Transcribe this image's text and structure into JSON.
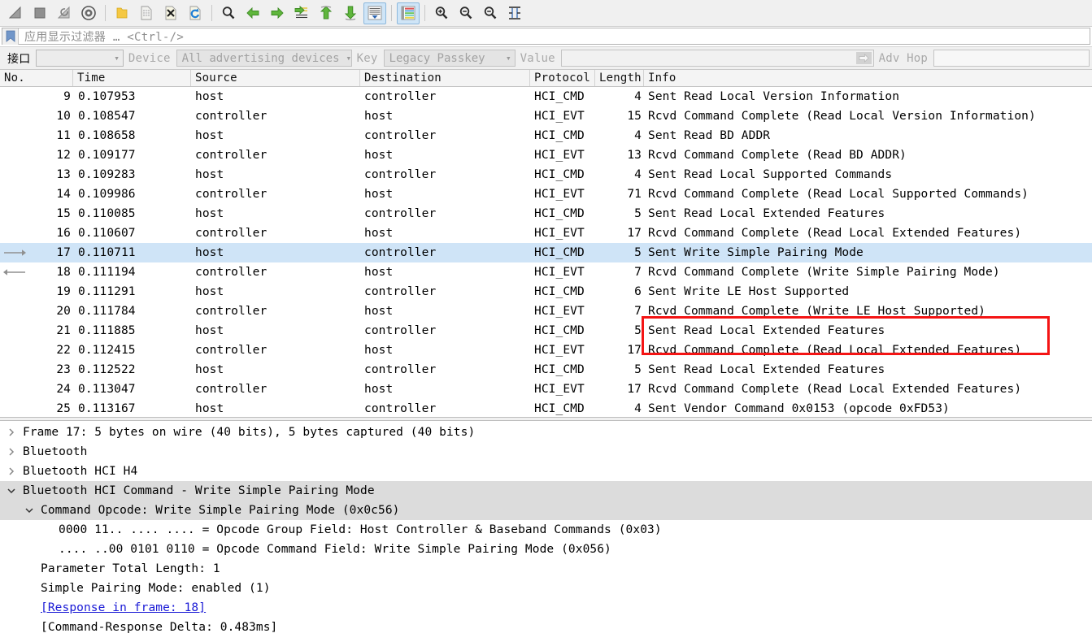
{
  "toolbar": {
    "buttons": [
      {
        "name": "start-capture-icon",
        "label": "Start"
      },
      {
        "name": "stop-capture-icon",
        "label": "Stop"
      },
      {
        "name": "restart-capture-icon",
        "label": "Restart"
      },
      {
        "name": "capture-options-icon",
        "label": "Capture Options"
      },
      {
        "name": "open-file-icon",
        "label": "Open"
      },
      {
        "name": "save-file-icon",
        "label": "Save"
      },
      {
        "name": "close-file-icon",
        "label": "Close"
      },
      {
        "name": "reload-file-icon",
        "label": "Reload"
      },
      {
        "name": "find-packet-icon",
        "label": "Find Packet"
      },
      {
        "name": "go-back-icon",
        "label": "Go Back"
      },
      {
        "name": "go-forward-icon",
        "label": "Go Forward"
      },
      {
        "name": "go-to-packet-icon",
        "label": "Go to Packet"
      },
      {
        "name": "go-to-first-icon",
        "label": "Go to First"
      },
      {
        "name": "go-to-last-icon",
        "label": "Go to Last"
      },
      {
        "name": "auto-scroll-icon",
        "label": "Auto Scroll in Live Capture",
        "active": true
      },
      {
        "name": "colorize-icon",
        "label": "Colorize Packet List",
        "active": true
      },
      {
        "name": "zoom-in-icon",
        "label": "Zoom In"
      },
      {
        "name": "zoom-out-icon",
        "label": "Zoom Out"
      },
      {
        "name": "normal-size-icon",
        "label": "Normal Size"
      },
      {
        "name": "resize-columns-icon",
        "label": "Resize Columns"
      }
    ]
  },
  "display_filter": {
    "bookmark_icon": "bookmark-icon",
    "placeholder": "应用显示过滤器 … <Ctrl-/>",
    "value": ""
  },
  "bt_toolbar": {
    "interface_label": "接口",
    "interface_value": "",
    "device_label": "Device",
    "device_value": "All advertising devices",
    "key_label": "Key",
    "key_value": "Legacy Passkey",
    "value_label": "Value",
    "value_value": "",
    "adv_hop_label": "Adv Hop",
    "adv_hop_value": ""
  },
  "packet_list": {
    "columns": [
      "No.",
      "Time",
      "Source",
      "Destination",
      "Protocol",
      "Length",
      "Info"
    ],
    "rows": [
      {
        "arrow": "",
        "no": "9",
        "time": "0.107953",
        "src": "host",
        "dst": "controller",
        "proto": "HCI_CMD",
        "len": "4",
        "info": "Sent Read Local Version Information",
        "selected": false
      },
      {
        "arrow": "",
        "no": "10",
        "time": "0.108547",
        "src": "controller",
        "dst": "host",
        "proto": "HCI_EVT",
        "len": "15",
        "info": "Rcvd Command Complete (Read Local Version Information)",
        "selected": false
      },
      {
        "arrow": "",
        "no": "11",
        "time": "0.108658",
        "src": "host",
        "dst": "controller",
        "proto": "HCI_CMD",
        "len": "4",
        "info": "Sent Read BD ADDR",
        "selected": false
      },
      {
        "arrow": "",
        "no": "12",
        "time": "0.109177",
        "src": "controller",
        "dst": "host",
        "proto": "HCI_EVT",
        "len": "13",
        "info": "Rcvd Command Complete (Read BD ADDR)",
        "selected": false
      },
      {
        "arrow": "",
        "no": "13",
        "time": "0.109283",
        "src": "host",
        "dst": "controller",
        "proto": "HCI_CMD",
        "len": "4",
        "info": "Sent Read Local Supported Commands",
        "selected": false
      },
      {
        "arrow": "",
        "no": "14",
        "time": "0.109986",
        "src": "controller",
        "dst": "host",
        "proto": "HCI_EVT",
        "len": "71",
        "info": "Rcvd Command Complete (Read Local Supported Commands)",
        "selected": false
      },
      {
        "arrow": "",
        "no": "15",
        "time": "0.110085",
        "src": "host",
        "dst": "controller",
        "proto": "HCI_CMD",
        "len": "5",
        "info": "Sent Read Local Extended Features",
        "selected": false
      },
      {
        "arrow": "",
        "no": "16",
        "time": "0.110607",
        "src": "controller",
        "dst": "host",
        "proto": "HCI_EVT",
        "len": "17",
        "info": "Rcvd Command Complete (Read Local Extended Features)",
        "selected": false
      },
      {
        "arrow": "→",
        "no": "17",
        "time": "0.110711",
        "src": "host",
        "dst": "controller",
        "proto": "HCI_CMD",
        "len": "5",
        "info": "Sent Write Simple Pairing Mode",
        "selected": true
      },
      {
        "arrow": "←",
        "no": "18",
        "time": "0.111194",
        "src": "controller",
        "dst": "host",
        "proto": "HCI_EVT",
        "len": "7",
        "info": "Rcvd Command Complete (Write Simple Pairing Mode)",
        "selected": false
      },
      {
        "arrow": "",
        "no": "19",
        "time": "0.111291",
        "src": "host",
        "dst": "controller",
        "proto": "HCI_CMD",
        "len": "6",
        "info": "Sent Write LE Host Supported",
        "selected": false
      },
      {
        "arrow": "",
        "no": "20",
        "time": "0.111784",
        "src": "controller",
        "dst": "host",
        "proto": "HCI_EVT",
        "len": "7",
        "info": "Rcvd Command Complete (Write LE Host Supported)",
        "selected": false
      },
      {
        "arrow": "",
        "no": "21",
        "time": "0.111885",
        "src": "host",
        "dst": "controller",
        "proto": "HCI_CMD",
        "len": "5",
        "info": "Sent Read Local Extended Features",
        "selected": false
      },
      {
        "arrow": "",
        "no": "22",
        "time": "0.112415",
        "src": "controller",
        "dst": "host",
        "proto": "HCI_EVT",
        "len": "17",
        "info": "Rcvd Command Complete (Read Local Extended Features)",
        "selected": false
      },
      {
        "arrow": "",
        "no": "23",
        "time": "0.112522",
        "src": "host",
        "dst": "controller",
        "proto": "HCI_CMD",
        "len": "5",
        "info": "Sent Read Local Extended Features",
        "selected": false
      },
      {
        "arrow": "",
        "no": "24",
        "time": "0.113047",
        "src": "controller",
        "dst": "host",
        "proto": "HCI_EVT",
        "len": "17",
        "info": "Rcvd Command Complete (Read Local Extended Features)",
        "selected": false
      },
      {
        "arrow": "",
        "no": "25",
        "time": "0.113167",
        "src": "host",
        "dst": "controller",
        "proto": "HCI_CMD",
        "len": "4",
        "info": "Sent Vendor Command 0x0153 (opcode 0xFD53)",
        "selected": false
      }
    ],
    "annotation_color": "#f41414"
  },
  "detail_tree": [
    {
      "indent": 0,
      "twisty": "collapsed",
      "text": "Frame 17: 5 bytes on wire (40 bits), 5 bytes captured (40 bits)",
      "selected": false,
      "link": false
    },
    {
      "indent": 0,
      "twisty": "collapsed",
      "text": "Bluetooth",
      "selected": false,
      "link": false
    },
    {
      "indent": 0,
      "twisty": "collapsed",
      "text": "Bluetooth HCI H4",
      "selected": false,
      "link": false
    },
    {
      "indent": 0,
      "twisty": "expanded",
      "text": "Bluetooth HCI Command - Write Simple Pairing Mode",
      "selected": true,
      "link": false
    },
    {
      "indent": 1,
      "twisty": "expanded",
      "text": "Command Opcode: Write Simple Pairing Mode (0x0c56)",
      "selected": true,
      "link": false
    },
    {
      "indent": 2,
      "twisty": "none",
      "text": "0000 11.. .... .... = Opcode Group Field: Host Controller & Baseband Commands (0x03)",
      "selected": false,
      "link": false
    },
    {
      "indent": 2,
      "twisty": "none",
      "text": ".... ..00 0101 0110 = Opcode Command Field: Write Simple Pairing Mode (0x056)",
      "selected": false,
      "link": false
    },
    {
      "indent": 1,
      "twisty": "none",
      "text": "Parameter Total Length: 1",
      "selected": false,
      "link": false
    },
    {
      "indent": 1,
      "twisty": "none",
      "text": "Simple Pairing Mode: enabled (1)",
      "selected": false,
      "link": false
    },
    {
      "indent": 1,
      "twisty": "none",
      "text": "[Response in frame: 18]",
      "selected": false,
      "link": true
    },
    {
      "indent": 1,
      "twisty": "none",
      "text": "[Command-Response Delta: 0.483ms]",
      "selected": false,
      "link": false
    }
  ]
}
